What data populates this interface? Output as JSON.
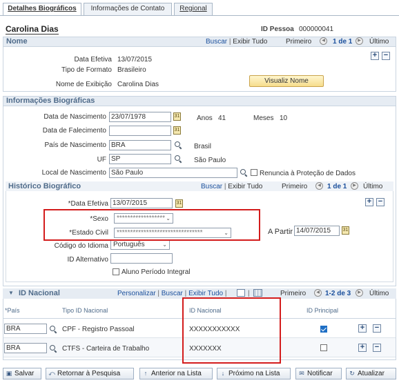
{
  "tabs": [
    {
      "label": "Detalhes Biográficos",
      "active": true
    },
    {
      "label": "Informações de Contato",
      "active": false
    },
    {
      "label": "Regional",
      "active": false
    }
  ],
  "person": {
    "name": "Carolina Dias",
    "id_label": "ID Pessoa",
    "id_value": "000000041"
  },
  "nome": {
    "title": "Nome",
    "nav": {
      "buscar": "Buscar",
      "exibir": "Exibir Tudo",
      "primeiro": "Primeiro",
      "counter": "1 de 1",
      "ultimo": "Último"
    },
    "data_efetiva_label": "Data Efetiva",
    "data_efetiva_value": "13/07/2015",
    "tipo_formato_label": "Tipo de Formato",
    "tipo_formato_value": "Brasileiro",
    "nome_exibicao_label": "Nome de Exibição",
    "nome_exibicao_value": "Carolina Dias",
    "visualiz_button": "Visualiz Nome"
  },
  "bio": {
    "title": "Informações Biográficas",
    "nascimento_label": "Data de Nascimento",
    "nascimento_value": "23/07/1978",
    "anos_label": "Anos",
    "anos_value": "41",
    "meses_label": "Meses",
    "meses_value": "10",
    "falecimento_label": "Data de Falecimento",
    "falecimento_value": "",
    "pais_label": "País de Nascimento",
    "pais_value": "BRA",
    "pais_desc": "Brasil",
    "uf_label": "UF",
    "uf_value": "SP",
    "uf_desc": "São Paulo",
    "local_label": "Local de Nascimento",
    "local_value": "São Paulo",
    "renuncia_label": "Renuncia à Proteção de Dados"
  },
  "historico": {
    "title": "Histórico Biográfico",
    "nav": {
      "buscar": "Buscar",
      "exibir": "Exibir Tudo",
      "primeiro": "Primeiro",
      "counter": "1 de 1",
      "ultimo": "Último"
    },
    "data_efetiva_label": "*Data Efetiva",
    "data_efetiva_value": "13/07/2015",
    "sexo_label": "*Sexo",
    "sexo_value": "******************",
    "estado_civil_label": "*Estado Civil",
    "estado_civil_value": "********************************",
    "a_partir_label": "A Partir",
    "a_partir_value": "14/07/2015",
    "idioma_label": "Código do Idioma",
    "idioma_value": "Português",
    "id_alt_label": "ID Alternativo",
    "id_alt_value": "",
    "aluno_label": "Aluno Período Integral"
  },
  "id_nacional": {
    "title": "ID Nacional",
    "nav": {
      "personalizar": "Personalizar",
      "buscar": "Buscar",
      "exibir": "Exibir Tudo",
      "primeiro": "Primeiro",
      "counter": "1-2 de 3",
      "ultimo": "Último"
    },
    "columns": {
      "pais": "*País",
      "tipo": "Tipo ID Nacional",
      "id": "ID Nacional",
      "principal": "ID Principal"
    },
    "rows": [
      {
        "pais": "BRA",
        "tipo": "CPF - Registro Passoal",
        "id": "XXXXXXXXXXX",
        "principal": true
      },
      {
        "pais": "BRA",
        "tipo": "CTFS - Carteira de Trabalho",
        "id": "XXXXXXX",
        "principal": false
      }
    ]
  },
  "toolbar": {
    "salvar": "Salvar",
    "retornar": "Retornar à Pesquisa",
    "anterior": "Anterior na Lista",
    "proximo": "Próximo na Lista",
    "notificar": "Notificar",
    "atualizar": "Atualizar"
  }
}
